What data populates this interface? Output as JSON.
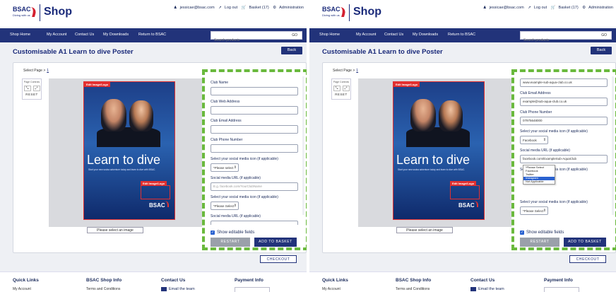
{
  "header": {
    "logo_text": "BSAC",
    "logo_sub": "Diving with us",
    "shop_title": "Shop",
    "user_email": "jessicae@bsac.com",
    "logout": "Log out",
    "basket": "Basket (17)",
    "admin": "Administration"
  },
  "nav": {
    "items": [
      "Shop Home",
      "My Account",
      "Contact Us",
      "My Downloads",
      "Return to BSAC"
    ],
    "search_placeholder": "Search products",
    "search_go": "GO"
  },
  "page": {
    "title": "Customisable A1 Learn to dive Poster",
    "back": "Back",
    "select_page_label": "Select Page >",
    "select_page_value": "1",
    "page_controls_label": "Page Controls",
    "reset": "RESET",
    "select_image": "Please select an image",
    "checkout": "CHECKOUT"
  },
  "poster": {
    "edit_top": "Edit Image/Logo",
    "headline": "Learn to dive",
    "sub": "Start your new scuba adventure today and learn to dive with BSAC.",
    "edit_logo": "Edit Image/Logo",
    "brand": "BSAC"
  },
  "left_form": {
    "fields": [
      {
        "label": "Club Name",
        "value": ""
      },
      {
        "label": "Club Web Address",
        "value": ""
      },
      {
        "label": "Club Email Address",
        "value": ""
      },
      {
        "label": "Club Phone Number",
        "value": ""
      }
    ],
    "social_label": "Select your social media icon (if applicable)",
    "social_select": "*Please select",
    "social_url_label": "Social media URL (if applicable)",
    "social_url_placeholder": "E.g. facebook.com/YourClubName",
    "social_label_2": "Select your social media icon (if applicable)",
    "social_select_2": "*Please Select",
    "social_url_label_2": "Social media URL (if applicable)"
  },
  "right_form": {
    "field_top_value": "www.example-sub-aqua-club.co.uk",
    "email_label": "Club Email Address",
    "email_value": "example@sub-aqua-club.co.uk",
    "phone_label": "Club Phone Number",
    "phone_value": "07975648000",
    "social_label": "Select your social media icon (if applicable)",
    "social_select": "Facebook",
    "social_url_label": "Social media URL (if applicable)",
    "social_url_value": "facebook.com/ExampleSub-AquaClub",
    "social_label_2": "Select your social media icon (if applicable)",
    "social_label_3": "Select your social media icon (if applicable)",
    "social_select_3": "*Please Select",
    "dropdown": [
      "*Please Select",
      "Facebook",
      "Twitter",
      "Instagram",
      "Not Applicable"
    ]
  },
  "controls": {
    "show_editable": "Show editable fields",
    "restart": "RESTART",
    "add_to_basket": "ADD TO BASKET"
  },
  "footer": {
    "quick_links": "Quick Links",
    "my_account": "My Account",
    "shop_info": "BSAC Shop Info",
    "terms": "Terms and Conditions",
    "contact": "Contact Us",
    "email_team": "Email the team",
    "payment": "Payment Info"
  }
}
